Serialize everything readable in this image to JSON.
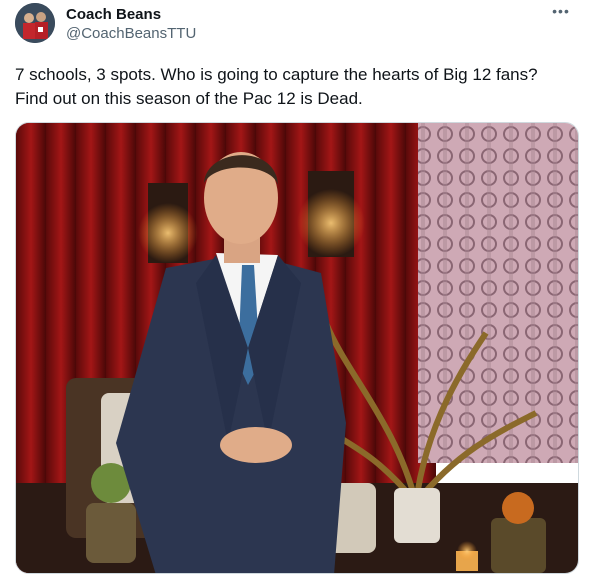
{
  "author": {
    "display_name": "Coach Beans",
    "handle": "@CoachBeansTTU",
    "avatar_icon": "avatar-photo"
  },
  "menu": {
    "more_label": "•••",
    "icon": "more-icon"
  },
  "tweet": {
    "text": "7 schools, 3 spots. Who is going to capture the hearts of Big 12 fans?\nFind out on this season of the Pac 12 is Dead."
  },
  "media": {
    "description_icon": "photo-host-on-stage"
  },
  "colors": {
    "text": "#0f1419",
    "secondary": "#536471",
    "border": "#cfd9de",
    "curtain": "#8e1414",
    "suit": "#2c3650",
    "tie": "#3c6e9e"
  }
}
